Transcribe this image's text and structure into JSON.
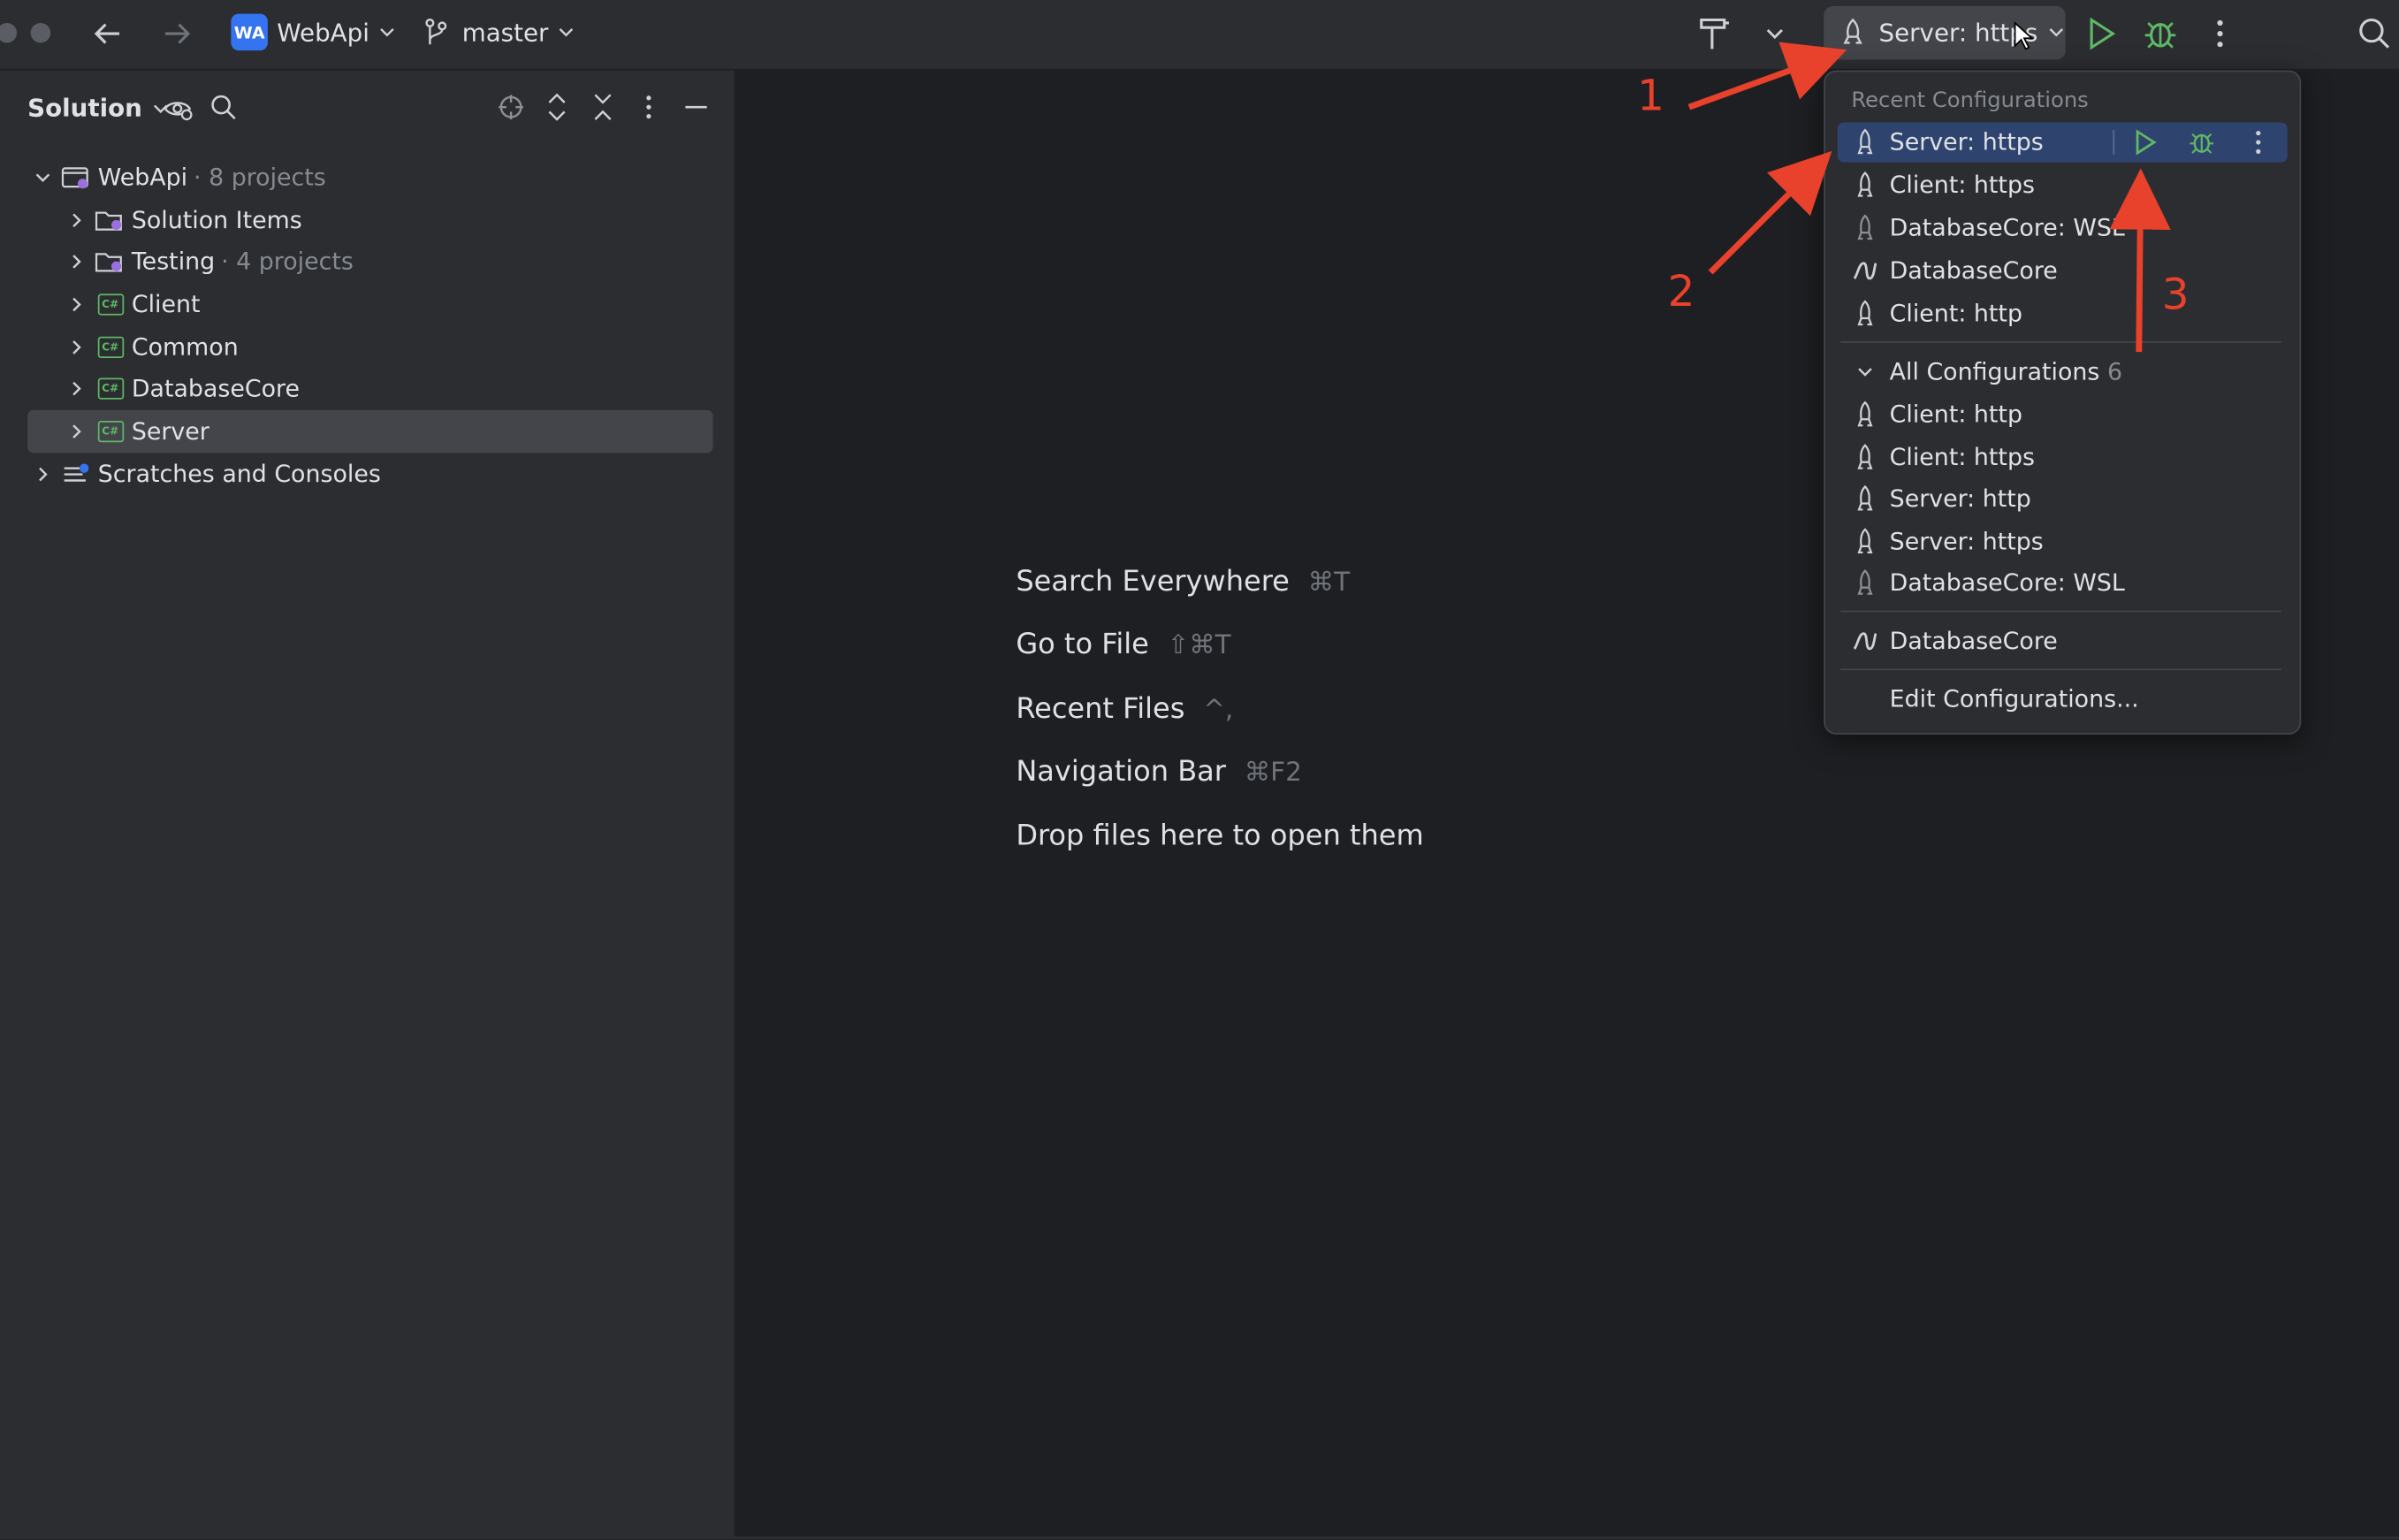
{
  "toolbar": {
    "project_badge": "WA",
    "project_name": "WebApi",
    "branch": "master",
    "run_config": "Server: https"
  },
  "solution_panel": {
    "title": "Solution",
    "tree": [
      {
        "label": "WebApi",
        "suffix": "· 8 projects",
        "expanded": true,
        "icon": "solution-icon"
      },
      {
        "label": "Solution Items",
        "suffix": "",
        "icon": "folder-icon"
      },
      {
        "label": "Testing",
        "suffix": "· 4 projects",
        "icon": "folder-icon"
      },
      {
        "label": "Client",
        "suffix": "",
        "icon": "csharp-project-icon"
      },
      {
        "label": "Common",
        "suffix": "",
        "icon": "csharp-project-icon"
      },
      {
        "label": "DatabaseCore",
        "suffix": "",
        "icon": "csharp-project-icon"
      },
      {
        "label": "Server",
        "suffix": "",
        "icon": "csharp-project-icon",
        "selected": true
      },
      {
        "label": "Scratches and Consoles",
        "suffix": "",
        "icon": "scratches-icon"
      }
    ],
    "csharp_icon_text": "C#"
  },
  "editor_hints": [
    {
      "label": "Search Everywhere",
      "shortcut": "⌘T"
    },
    {
      "label": "Go to File",
      "shortcut": "⇧⌘T"
    },
    {
      "label": "Recent Files",
      "shortcut": "^,"
    },
    {
      "label": "Navigation Bar",
      "shortcut": "⌘F2"
    },
    {
      "label": "Drop files here to open them",
      "shortcut": ""
    }
  ],
  "run_popup": {
    "recent_header": "Recent Configurations",
    "recent": [
      {
        "label": "Server: https",
        "icon": "rocket-icon",
        "active": true
      },
      {
        "label": "Client: https",
        "icon": "rocket-icon"
      },
      {
        "label": "DatabaseCore: WSL",
        "icon": "rocket-icon"
      },
      {
        "label": "DatabaseCore",
        "icon": "wave-icon"
      },
      {
        "label": "Client: http",
        "icon": "rocket-icon"
      }
    ],
    "all_header": "All Configurations",
    "all_count": "6",
    "all": [
      {
        "label": "Client: http",
        "icon": "rocket-icon"
      },
      {
        "label": "Client: https",
        "icon": "rocket-icon"
      },
      {
        "label": "Server: http",
        "icon": "rocket-icon"
      },
      {
        "label": "Server: https",
        "icon": "rocket-icon"
      },
      {
        "label": "DatabaseCore: WSL",
        "icon": "rocket-icon"
      }
    ],
    "extra": {
      "label": "DatabaseCore",
      "icon": "wave-icon"
    },
    "edit_label": "Edit Configurations..."
  },
  "annotations": [
    "1",
    "2",
    "3"
  ],
  "colors": {
    "accent": "#3574f0",
    "selection": "#2e436e",
    "run_green": "#5fb865",
    "annotation_red": "#e8412c"
  }
}
